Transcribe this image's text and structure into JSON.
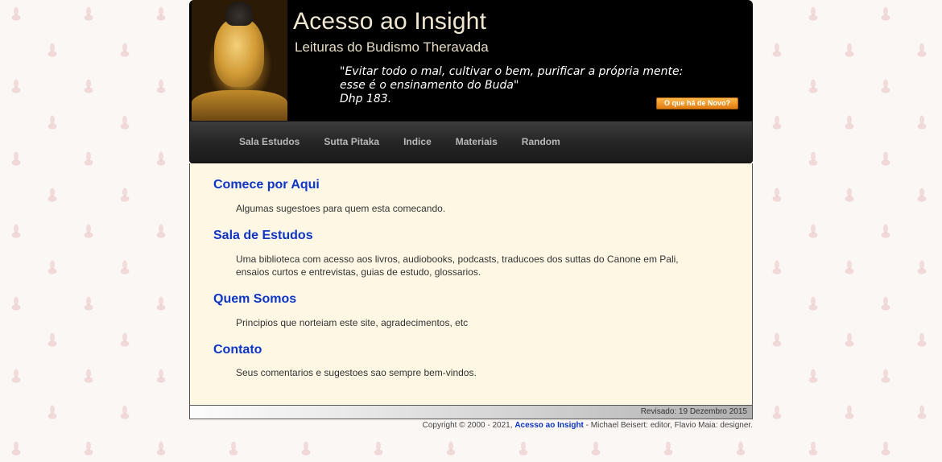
{
  "header": {
    "title": "Acesso ao Insight",
    "subtitle": "Leituras do Budismo Theravada",
    "quote": "\"Evitar todo o mal, cultivar o bem, purificar a própria mente:\nesse é o ensinamento do Buda\"\nDhp 183.",
    "news_button": "O que há de Novo?"
  },
  "nav": {
    "items": [
      "Sala Estudos",
      "Sutta Pitaka",
      "Indice",
      "Materiais",
      "Random"
    ]
  },
  "sections": [
    {
      "title": "Comece por Aqui",
      "text": "Algumas sugestoes para quem esta comecando."
    },
    {
      "title": "Sala de Estudos",
      "text": "Uma biblioteca com acesso aos livros, audiobooks, podcasts, traducoes dos suttas do Canone em Pali, ensaios curtos e entrevistas, guias de estudo, glossarios."
    },
    {
      "title": "Quem Somos",
      "text": "Principios que norteiam este site, agradecimentos, etc"
    },
    {
      "title": "Contato",
      "text": "Seus comentarios e sugestoes sao sempre bem-vindos."
    }
  ],
  "footer": {
    "revised": "Revisado: 19 Dezembro 2015",
    "copyright_prefix": "Copyright © 2000 - 2021,",
    "site_link": "Acesso ao Insight",
    "copyright_suffix": "- Michael Beisert: editor, Flavio Maia: designer."
  }
}
